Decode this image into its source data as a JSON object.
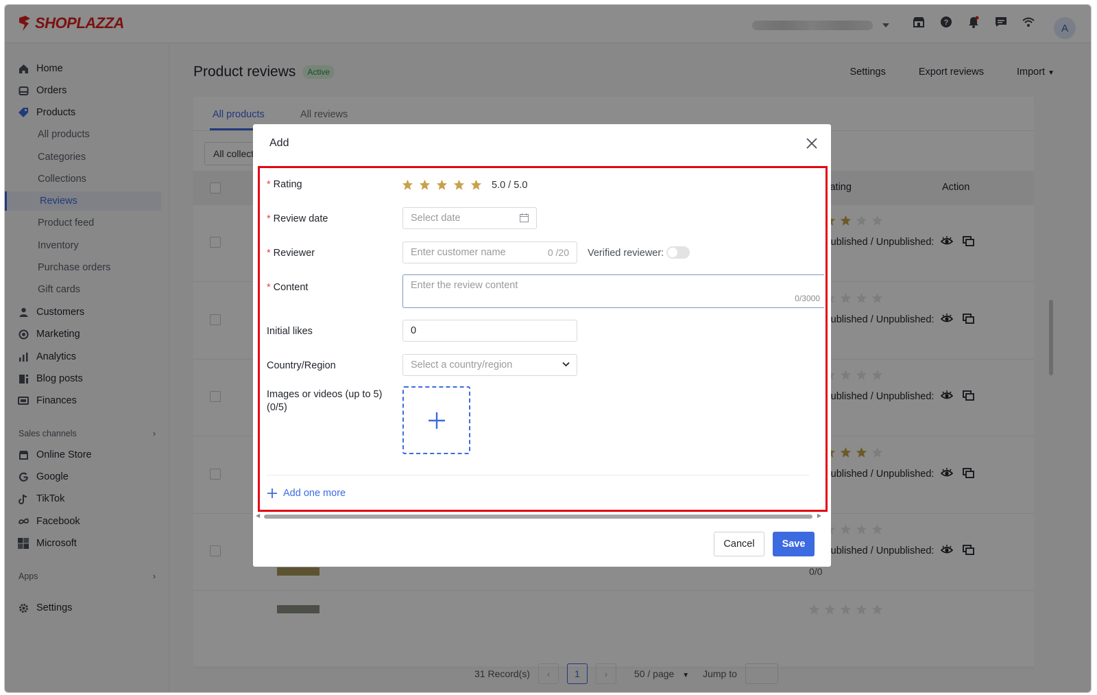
{
  "app": {
    "logo_text": "SHOPLAZZA",
    "avatar_initial": "A"
  },
  "colors": {
    "accent": "#3c6ae0",
    "brand": "#e02020",
    "star_filled": "#c8a24b",
    "star_empty": "#e3e3e3",
    "highlight_border": "#e30613",
    "active_badge_bg": "#d9f2dd"
  },
  "topbar": {
    "icons": [
      "store-icon",
      "help-icon",
      "bell-icon",
      "chat-icon",
      "wifi-icon"
    ]
  },
  "sidebar": {
    "items": [
      {
        "label": "Home",
        "icon": "home-icon"
      },
      {
        "label": "Orders",
        "icon": "orders-icon"
      },
      {
        "label": "Products",
        "icon": "tag-icon"
      }
    ],
    "product_sub": [
      "All products",
      "Categories",
      "Collections",
      "Reviews",
      "Product feed",
      "Inventory",
      "Purchase orders",
      "Gift cards"
    ],
    "items2": [
      {
        "label": "Customers",
        "icon": "person-icon"
      },
      {
        "label": "Marketing",
        "icon": "marketing-icon"
      },
      {
        "label": "Analytics",
        "icon": "analytics-icon"
      },
      {
        "label": "Blog posts",
        "icon": "blog-icon"
      },
      {
        "label": "Finances",
        "icon": "finances-icon"
      }
    ],
    "sales_channels_label": "Sales channels",
    "channels": [
      {
        "label": "Online Store",
        "icon": "store-icon"
      },
      {
        "label": "Google",
        "icon": "google-icon"
      },
      {
        "label": "TikTok",
        "icon": "tiktok-icon"
      },
      {
        "label": "Facebook",
        "icon": "meta-icon"
      },
      {
        "label": "Microsoft",
        "icon": "microsoft-icon"
      }
    ],
    "apps_label": "Apps",
    "settings_label": "Settings"
  },
  "page": {
    "title": "Product reviews",
    "status_badge": "Active",
    "actions": {
      "settings": "Settings",
      "export": "Export reviews",
      "import": "Import"
    },
    "tabs": [
      "All products",
      "All reviews"
    ],
    "filter_value": "All collections",
    "columns": {
      "rating": "Rating",
      "action": "Action"
    },
    "rows": [
      {
        "rating": 3,
        "status": "Published / Unpublished:",
        "counts": ""
      },
      {
        "rating": 0,
        "status": "Published / Unpublished:",
        "counts": ""
      },
      {
        "rating": 0,
        "status": "Published / Unpublished:",
        "counts": ""
      },
      {
        "rating": 4,
        "status": "Published / Unpublished:",
        "counts": ""
      },
      {
        "rating": 0,
        "status": "Published / Unpublished:",
        "counts": "0/0"
      },
      {
        "rating": 0,
        "status": "",
        "counts": ""
      }
    ],
    "pagination": {
      "records": "31 Record(s)",
      "current_page": "1",
      "page_size": "50 / page",
      "jump_label": "Jump to"
    }
  },
  "modal": {
    "title": "Add",
    "rating": {
      "label": "Rating",
      "value": 5,
      "display": "5.0 / 5.0"
    },
    "review_date": {
      "label": "Review date",
      "placeholder": "Select date"
    },
    "reviewer": {
      "label": "Reviewer",
      "placeholder": "Enter customer name",
      "counter": "0 /20",
      "verified_label": "Verified reviewer:",
      "verified": false
    },
    "content": {
      "label": "Content",
      "placeholder": "Enter the review content",
      "counter": "0/3000"
    },
    "initial_likes": {
      "label": "Initial likes",
      "value": "0"
    },
    "country": {
      "label": "Country/Region",
      "placeholder": "Select a country/region"
    },
    "media": {
      "label": "Images or videos (up to 5)",
      "count": "(0/5)"
    },
    "add_more": "Add one more",
    "cancel": "Cancel",
    "save": "Save"
  }
}
